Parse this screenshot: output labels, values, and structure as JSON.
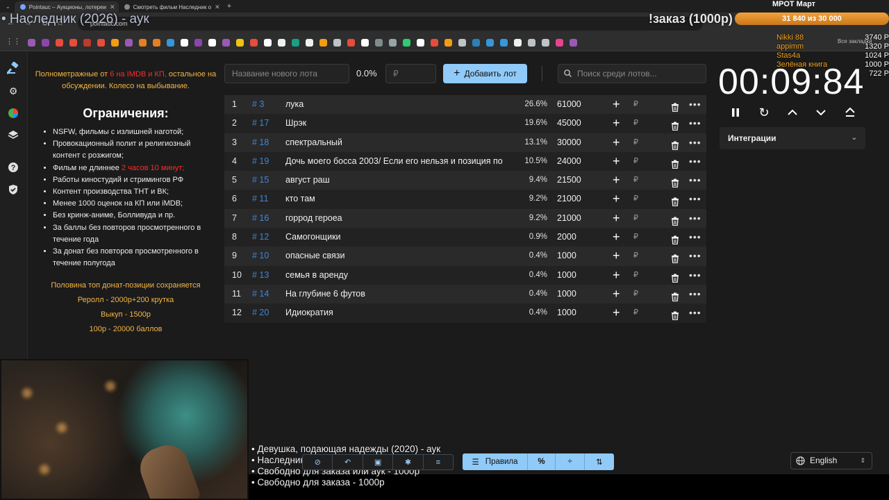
{
  "browser": {
    "tabs": [
      {
        "label": "Pointauc – Аукционы, лотереи"
      },
      {
        "label": "Смотреть фильм Наследник о"
      }
    ],
    "url": "pointauc.com",
    "all_bookmarks": "Все закладки",
    "bookmark_colors": [
      "#9b59b6",
      "#8e44ad",
      "#e74c3c",
      "#e74c3c",
      "#c0392b",
      "#e74c3c",
      "#f39c12",
      "#9b59b6",
      "#e67e22",
      "#e67e22",
      "#3498db",
      "#ffffff",
      "#8e44ad",
      "#ffffff",
      "#9b59b6",
      "#f1c40f",
      "#e74c3c",
      "#ffffff",
      "#ecf0f1",
      "#16a085",
      "#ecf0f1",
      "#f39c12",
      "#bdc3c7",
      "#e74c3c",
      "#ffffff",
      "#7f8c8d",
      "#95a5a6",
      "#2ecc71",
      "#ffffff",
      "#e74c3c",
      "#f39c12",
      "#bdc3c7",
      "#2980b9",
      "#3498db",
      "#3498db",
      "#ecf0f1",
      "#bdc3c7",
      "#bdc3c7",
      "#e84393",
      "#9b59b6"
    ]
  },
  "overlay": {
    "title": "• Наследник (2026) - аук",
    "order": "!заказ (1000р)",
    "mrot": "МРОТ Март",
    "goal": "31 840 из 30 000",
    "donors": [
      {
        "name": "Nikki 88",
        "value": "3740 Р"
      },
      {
        "name": "appimm",
        "value": "1320 Р"
      },
      {
        "name": "Stas4a",
        "value": "1024 Р"
      },
      {
        "name": "Зелёная книга",
        "value": "1000 Р"
      },
      {
        "name": "",
        "value": "722 Р"
      }
    ]
  },
  "rules": {
    "intro_a": "Полнометражные от ",
    "intro_red": "6 на IMDB и КП,",
    "intro_b": " остальное на обсуждении. Колесо на выбывание.",
    "heading": "Ограничения:",
    "items": [
      "NSFW, фильмы с излишней наготой;",
      "Провокационный полит и религиозный контент с розжигом;",
      "Фильм не длиннее ",
      "Работы киностудий и стримингов РФ",
      "Контент производства ТНТ и ВК;",
      "Менее 1000 оценок на КП или iMDB;",
      "Без кринж-аниме, Болливуда и пр.",
      "За баллы без повторов просмотренного в течение года",
      "За донат без повторов просмотренного в течение полугода"
    ],
    "item3_red": "2 часов 10 минут;",
    "footer": [
      "Половина топ донат-позиции сохраняется",
      "Реролл - 2000р+200 крутка",
      "Выкуп - 1500р",
      "100р - 20000 баллов"
    ]
  },
  "addbar": {
    "name_placeholder": "Название нового лота",
    "percent": "0.0%",
    "amount_placeholder": "₽",
    "add_label": "Добавить лот",
    "search_placeholder": "Поиск среди лотов..."
  },
  "lots": [
    {
      "n": "1",
      "id": "# 3",
      "name": "лука",
      "pct": "26.6%",
      "amount": "61000"
    },
    {
      "n": "2",
      "id": "# 17",
      "name": "Шрэк",
      "pct": "19.6%",
      "amount": "45000"
    },
    {
      "n": "3",
      "id": "# 18",
      "name": "спектральный",
      "pct": "13.1%",
      "amount": "30000"
    },
    {
      "n": "4",
      "id": "# 19",
      "name": "Дочь моего босса 2003/ Если его нельзя и позиция по",
      "pct": "10.5%",
      "amount": "24000"
    },
    {
      "n": "5",
      "id": "# 15",
      "name": "август раш",
      "pct": "9.4%",
      "amount": "21500"
    },
    {
      "n": "6",
      "id": "# 11",
      "name": "кто там",
      "pct": "9.2%",
      "amount": "21000"
    },
    {
      "n": "7",
      "id": "# 16",
      "name": "горрод героеа",
      "pct": "9.2%",
      "amount": "21000"
    },
    {
      "n": "8",
      "id": "# 12",
      "name": "Самогонщики",
      "pct": "0.9%",
      "amount": "2000"
    },
    {
      "n": "9",
      "id": "# 10",
      "name": "опасные связи",
      "pct": "0.4%",
      "amount": "1000"
    },
    {
      "n": "10",
      "id": "# 13",
      "name": "семья в аренду",
      "pct": "0.4%",
      "amount": "1000"
    },
    {
      "n": "11",
      "id": "# 14",
      "name": "На глубине 6 футов",
      "pct": "0.4%",
      "amount": "1000"
    },
    {
      "n": "12",
      "id": "# 20",
      "name": "Идиократия",
      "pct": "0.4%",
      "amount": "1000"
    }
  ],
  "lot_currency": "₽",
  "timer": "00:09:84",
  "integrations": "Интеграции",
  "queue": [
    "• Девушка, подающая надежды (2020) - аук",
    "• Наследник (2026) - аук",
    "• Свободно для заказа или аук - 1000р",
    "• Свободно для заказа - 1000р"
  ],
  "toolbar": {
    "rules_label": "Правила",
    "percent_label": "%"
  },
  "language": "English"
}
